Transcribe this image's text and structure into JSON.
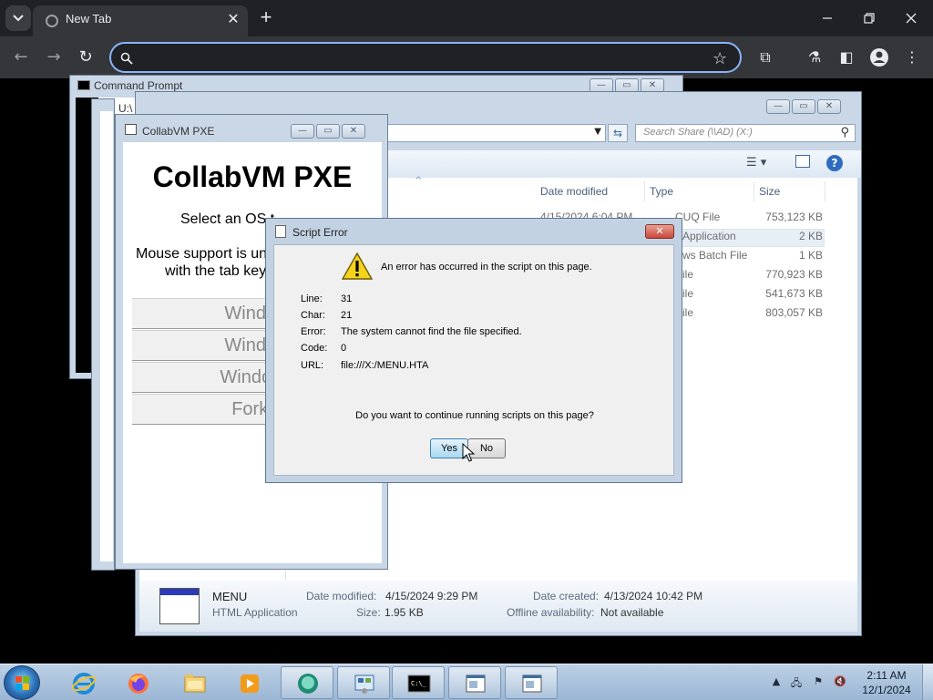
{
  "browser": {
    "tab_title": "New Tab",
    "tab_close": "✕",
    "new_tab": "+",
    "omnibox_value": "",
    "accent": "#8ab4f8"
  },
  "cmd_window": {
    "title": "Command Prompt",
    "inner_text": "U:\\"
  },
  "explorer": {
    "address_text": ")",
    "search_placeholder": "Search Share (\\\\AD) (X:)",
    "columns": [
      "Date modified",
      "Type",
      "Size"
    ],
    "rows": [
      {
        "date": "4/15/2024 6:04 PM",
        "type": "CUQ File",
        "size": "753,123 KB"
      },
      {
        "date": "",
        "type": "Application",
        "size": "2 KB"
      },
      {
        "date": "",
        "type": "ws Batch File",
        "size": "1 KB"
      },
      {
        "date": "",
        "type": "ile",
        "size": "770,923 KB"
      },
      {
        "date": "",
        "type": "ile",
        "size": "541,673 KB"
      },
      {
        "date": "",
        "type": "ile",
        "size": "803,057 KB"
      }
    ],
    "details": {
      "name": "MENU",
      "kind": "HTML Application",
      "modified_label": "Date modified:",
      "modified_value": "4/15/2024 9:29 PM",
      "size_label": "Size:",
      "size_value": "1.95 KB",
      "created_label": "Date created:",
      "created_value": "4/13/2024 10:42 PM",
      "offline_label": "Offline availability:",
      "offline_value": "Not available"
    }
  },
  "pxe": {
    "title": "CollabVM PXE",
    "heading": "CollabVM PXE",
    "line1": "Select an OS t",
    "line2": "Mouse support is un",
    "line3": "with the tab key",
    "buttons": [
      "Window",
      "Window",
      "Windows",
      "Forkie"
    ]
  },
  "script_error": {
    "title": "Script Error",
    "close": "✕",
    "message": "An error has occurred in the script on this page.",
    "fields": [
      {
        "key": "Line:",
        "value": "31"
      },
      {
        "key": "Char:",
        "value": "21"
      },
      {
        "key": "Error:",
        "value": "The system cannot find the file specified."
      },
      {
        "key": "Code:",
        "value": "0"
      },
      {
        "key": "URL:",
        "value": "file:///X:/MENU.HTA"
      }
    ],
    "question": "Do you want to continue running scripts on this page?",
    "yes_label": "Yes",
    "no_label": "No"
  },
  "taskbar": {
    "time": "2:11 AM",
    "date": "12/1/2024",
    "items": [
      "internet-explorer-icon",
      "firefox-icon",
      "file-explorer-icon",
      "media-player-icon",
      "collabvm-icon",
      "control-panel-icon",
      "command-prompt-icon",
      "hta-window-icon",
      "hta-window-icon"
    ]
  }
}
